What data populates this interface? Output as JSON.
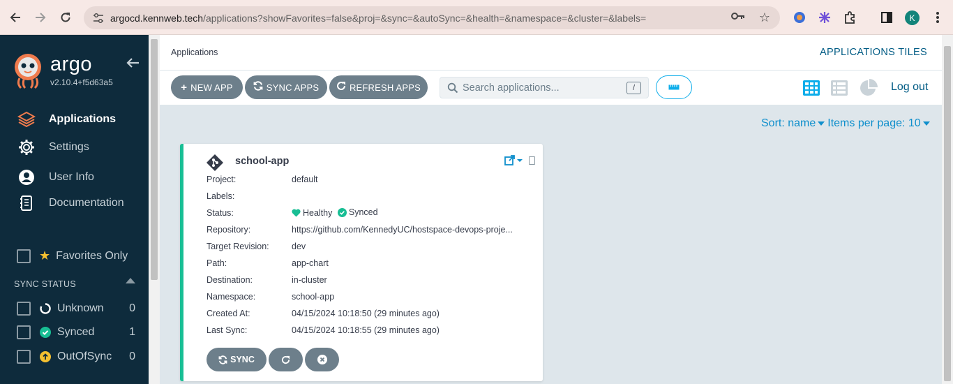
{
  "browser": {
    "url_host": "argocd.kennweb.tech",
    "url_path": "/applications?showFavorites=false&proj=&sync=&autoSync=&health=&namespace=&cluster=&labels=",
    "profile_initial": "K"
  },
  "sidebar": {
    "brand": "argo",
    "version": "v2.10.4+f5d63a5",
    "items": [
      {
        "label": "Applications",
        "icon": "layers-icon",
        "active": true
      },
      {
        "label": "Settings",
        "icon": "gear-icon"
      },
      {
        "label": "User Info",
        "icon": "user-icon"
      },
      {
        "label": "Documentation",
        "icon": "book-icon"
      }
    ],
    "favorites_label": "Favorites Only",
    "sync_status_header": "SYNC STATUS",
    "sync_filters": [
      {
        "label": "Unknown",
        "count": "0",
        "icon": "circle-notch-icon"
      },
      {
        "label": "Synced",
        "count": "1",
        "icon": "check-circle-icon"
      },
      {
        "label": "OutOfSync",
        "count": "0",
        "icon": "arrow-up-circle-icon"
      }
    ]
  },
  "header": {
    "breadcrumb": "Applications",
    "title": "APPLICATIONS TILES"
  },
  "toolbar": {
    "new_app": "NEW APP",
    "sync_apps": "SYNC APPS",
    "refresh_apps": "REFRESH APPS",
    "search_placeholder": "Search applications...",
    "search_shortcut": "/",
    "logout": "Log out"
  },
  "sort": {
    "sort_label": "Sort: name",
    "items_label": "Items per page: 10"
  },
  "app": {
    "name": "school-app",
    "fields": [
      {
        "label": "Project:",
        "value": "default"
      },
      {
        "label": "Labels:",
        "value": ""
      },
      {
        "label": "Status:",
        "value": ""
      },
      {
        "label": "Repository:",
        "value": "https://github.com/KennedyUC/hostspace-devops-proje..."
      },
      {
        "label": "Target Revision:",
        "value": "dev"
      },
      {
        "label": "Path:",
        "value": "app-chart"
      },
      {
        "label": "Destination:",
        "value": "in-cluster"
      },
      {
        "label": "Namespace:",
        "value": "school-app"
      },
      {
        "label": "Created At:",
        "value": "04/15/2024 10:18:50  (29 minutes ago)"
      },
      {
        "label": "Last Sync:",
        "value": "04/15/2024 10:18:55  (29 minutes ago)"
      }
    ],
    "health": "Healthy",
    "sync": "Synced",
    "sync_button": "SYNC"
  },
  "colors": {
    "sidebar_bg": "#0e2b3c",
    "healthy": "#18be94",
    "accent": "#0dadea",
    "link": "#005b84"
  }
}
